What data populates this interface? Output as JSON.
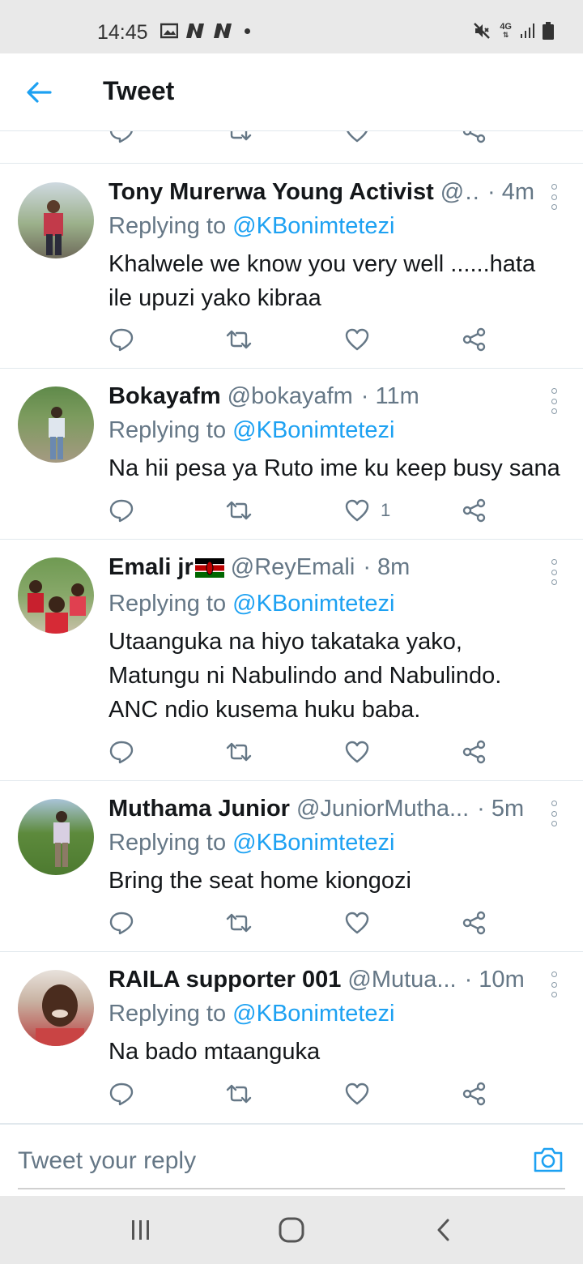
{
  "status_bar": {
    "time": "14:45",
    "network": "4G",
    "icons": [
      "image-icon",
      "n-icon",
      "n-icon",
      "dot-icon",
      "mute-icon",
      "signal-icon",
      "battery-icon"
    ]
  },
  "header": {
    "title": "Tweet",
    "back_icon": "back-arrow-icon",
    "accent": "#1da1f2"
  },
  "tweets": [
    {
      "name": "Tony Murerwa Young Activist",
      "handle": "@...",
      "time": "· 4m",
      "replying_prefix": "Replying to ",
      "replying_to": "@KBonimtetezi",
      "text_lines": [
        "Khalwele we know you very well ......hata",
        "ile upuzi yako kibraa"
      ],
      "like_count": ""
    },
    {
      "name": "Bokayafm",
      "handle": "@bokayafm",
      "time": "· 11m",
      "replying_prefix": "Replying to ",
      "replying_to": "@KBonimtetezi",
      "text_lines": [
        "Na hii pesa ya Ruto ime ku keep busy sana"
      ],
      "like_count": "1"
    },
    {
      "name": "Emali jr",
      "handle": "@ReyEmali",
      "time": "· 8m",
      "replying_prefix": "Replying to ",
      "replying_to": "@KBonimtetezi",
      "text_lines": [
        "Utaanguka na hiyo takataka yako,",
        "Matungu ni Nabulindo and Nabulindo.",
        "ANC ndio kusema huku baba."
      ],
      "like_count": ""
    },
    {
      "name": "Muthama Junior",
      "handle": "@JuniorMutha...",
      "time": "· 5m",
      "replying_prefix": "Replying to ",
      "replying_to": "@KBonimtetezi",
      "text_lines": [
        "Bring the seat home kiongozi"
      ],
      "like_count": ""
    },
    {
      "name": "RAILA supporter 001",
      "handle": "@Mutua...",
      "time": "· 10m",
      "replying_prefix": "Replying to ",
      "replying_to": "@KBonimtetezi",
      "text_lines": [
        "Na bado mtaanguka"
      ],
      "like_count": ""
    }
  ],
  "reply_bar": {
    "placeholder": "Tweet your reply",
    "camera_icon": "camera-icon"
  },
  "nav_bar": {
    "icons": [
      "recent-apps-icon",
      "home-icon",
      "back-icon"
    ]
  }
}
